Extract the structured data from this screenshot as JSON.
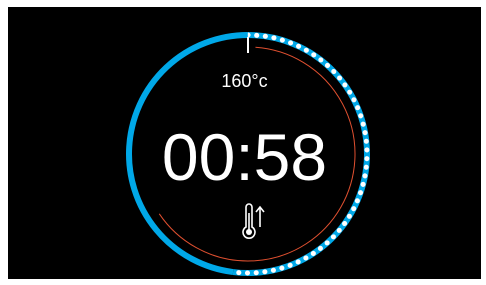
{
  "screen": {
    "background": "#000000"
  },
  "dial": {
    "temperature_label": "160°c",
    "timer_text": "00:58",
    "progress_fraction": 0.52,
    "colors": {
      "progress_arc": "#00a8e8",
      "dotted_ring": "#ffffff",
      "inner_arc": "#e05030",
      "needle": "#ffffff"
    }
  },
  "icons": {
    "status_icon": "thermometer-rising-icon"
  }
}
